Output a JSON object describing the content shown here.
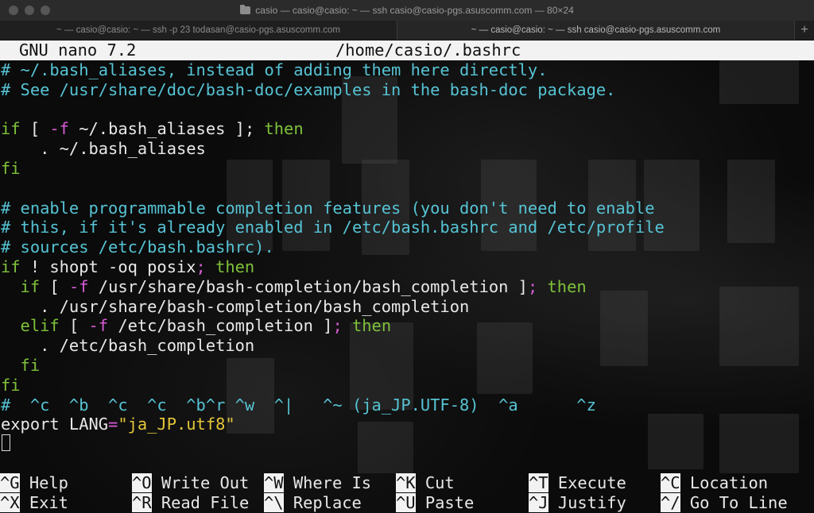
{
  "window": {
    "title": "casio — casio@casio: ~ — ssh casio@casio-pgs.asuscomm.com — 80×24"
  },
  "tabs": [
    {
      "label": "~ — casio@casio: ~ — ssh -p 23 todasan@casio-pgs.asuscomm.com",
      "active": false
    },
    {
      "label": "~ — casio@casio: ~ — ssh casio@casio-pgs.asuscomm.com",
      "active": true
    }
  ],
  "tab_add_label": "+",
  "nano": {
    "version": "GNU nano 7.2",
    "filename": "/home/casio/.bashrc"
  },
  "lines": [
    [
      {
        "t": "# ~/.bash_aliases, instead of adding them here directly.",
        "c": "com"
      }
    ],
    [
      {
        "t": "# See /usr/share/doc/bash-doc/examples in the bash-doc package.",
        "c": "com"
      }
    ],
    [],
    [
      {
        "t": "if",
        "c": "kw"
      },
      {
        "t": " [ ",
        "c": "txt"
      },
      {
        "t": "-f",
        "c": "op"
      },
      {
        "t": " ~/.bash_aliases ]; ",
        "c": "txt"
      },
      {
        "t": "then",
        "c": "kw"
      }
    ],
    [
      {
        "t": "    . ~/.bash_aliases",
        "c": "txt"
      }
    ],
    [
      {
        "t": "fi",
        "c": "kw"
      }
    ],
    [],
    [
      {
        "t": "# enable programmable completion features (you don't need to enable",
        "c": "com"
      }
    ],
    [
      {
        "t": "# this, if it's already enabled in /etc/bash.bashrc and /etc/profile",
        "c": "com"
      }
    ],
    [
      {
        "t": "# sources /etc/bash.bashrc).",
        "c": "com"
      }
    ],
    [
      {
        "t": "if",
        "c": "kw"
      },
      {
        "t": " ! shopt -oq posix",
        "c": "txt"
      },
      {
        "t": ";",
        "c": "op"
      },
      {
        "t": " then",
        "c": "kw"
      }
    ],
    [
      {
        "t": "  if",
        "c": "kw"
      },
      {
        "t": " [ ",
        "c": "txt"
      },
      {
        "t": "-f",
        "c": "op"
      },
      {
        "t": " /usr/share/bash-completion/bash_completion ]",
        "c": "txt"
      },
      {
        "t": ";",
        "c": "op"
      },
      {
        "t": " then",
        "c": "kw"
      }
    ],
    [
      {
        "t": "    . /usr/share/bash-completion/bash_completion",
        "c": "txt"
      }
    ],
    [
      {
        "t": "  elif",
        "c": "kw"
      },
      {
        "t": " [ ",
        "c": "txt"
      },
      {
        "t": "-f",
        "c": "op"
      },
      {
        "t": " /etc/bash_completion ]",
        "c": "txt"
      },
      {
        "t": ";",
        "c": "op"
      },
      {
        "t": " then",
        "c": "kw"
      }
    ],
    [
      {
        "t": "    . /etc/bash_completion",
        "c": "txt"
      }
    ],
    [
      {
        "t": "  fi",
        "c": "kw"
      }
    ],
    [
      {
        "t": "fi",
        "c": "kw"
      }
    ],
    [
      {
        "t": "#  ^c  ^b  ^c  ^c  ^b^r ^w  ^|   ^~ (ja_JP.UTF-8)  ^a      ^z",
        "c": "com"
      }
    ],
    [
      {
        "t": "export LANG",
        "c": "txt"
      },
      {
        "t": "=",
        "c": "op"
      },
      {
        "t": "\"ja_JP.utf8\"",
        "c": "str"
      }
    ]
  ],
  "shortcuts": [
    {
      "key": "^G",
      "label": "Help"
    },
    {
      "key": "^O",
      "label": "Write Out"
    },
    {
      "key": "^W",
      "label": "Where Is"
    },
    {
      "key": "^K",
      "label": "Cut"
    },
    {
      "key": "^T",
      "label": "Execute"
    },
    {
      "key": "^C",
      "label": "Location"
    },
    {
      "key": "^X",
      "label": "Exit"
    },
    {
      "key": "^R",
      "label": "Read File"
    },
    {
      "key": "^\\",
      "label": "Replace"
    },
    {
      "key": "^U",
      "label": "Paste"
    },
    {
      "key": "^J",
      "label": "Justify"
    },
    {
      "key": "^/",
      "label": "Go To Line"
    }
  ],
  "colors": {
    "comment": "#56c3d4",
    "keyword": "#7ec13a",
    "operator": "#d55bd5",
    "string": "#e2c53a",
    "text": "#e8e8e8",
    "header_bg": "#f2f2f2"
  }
}
